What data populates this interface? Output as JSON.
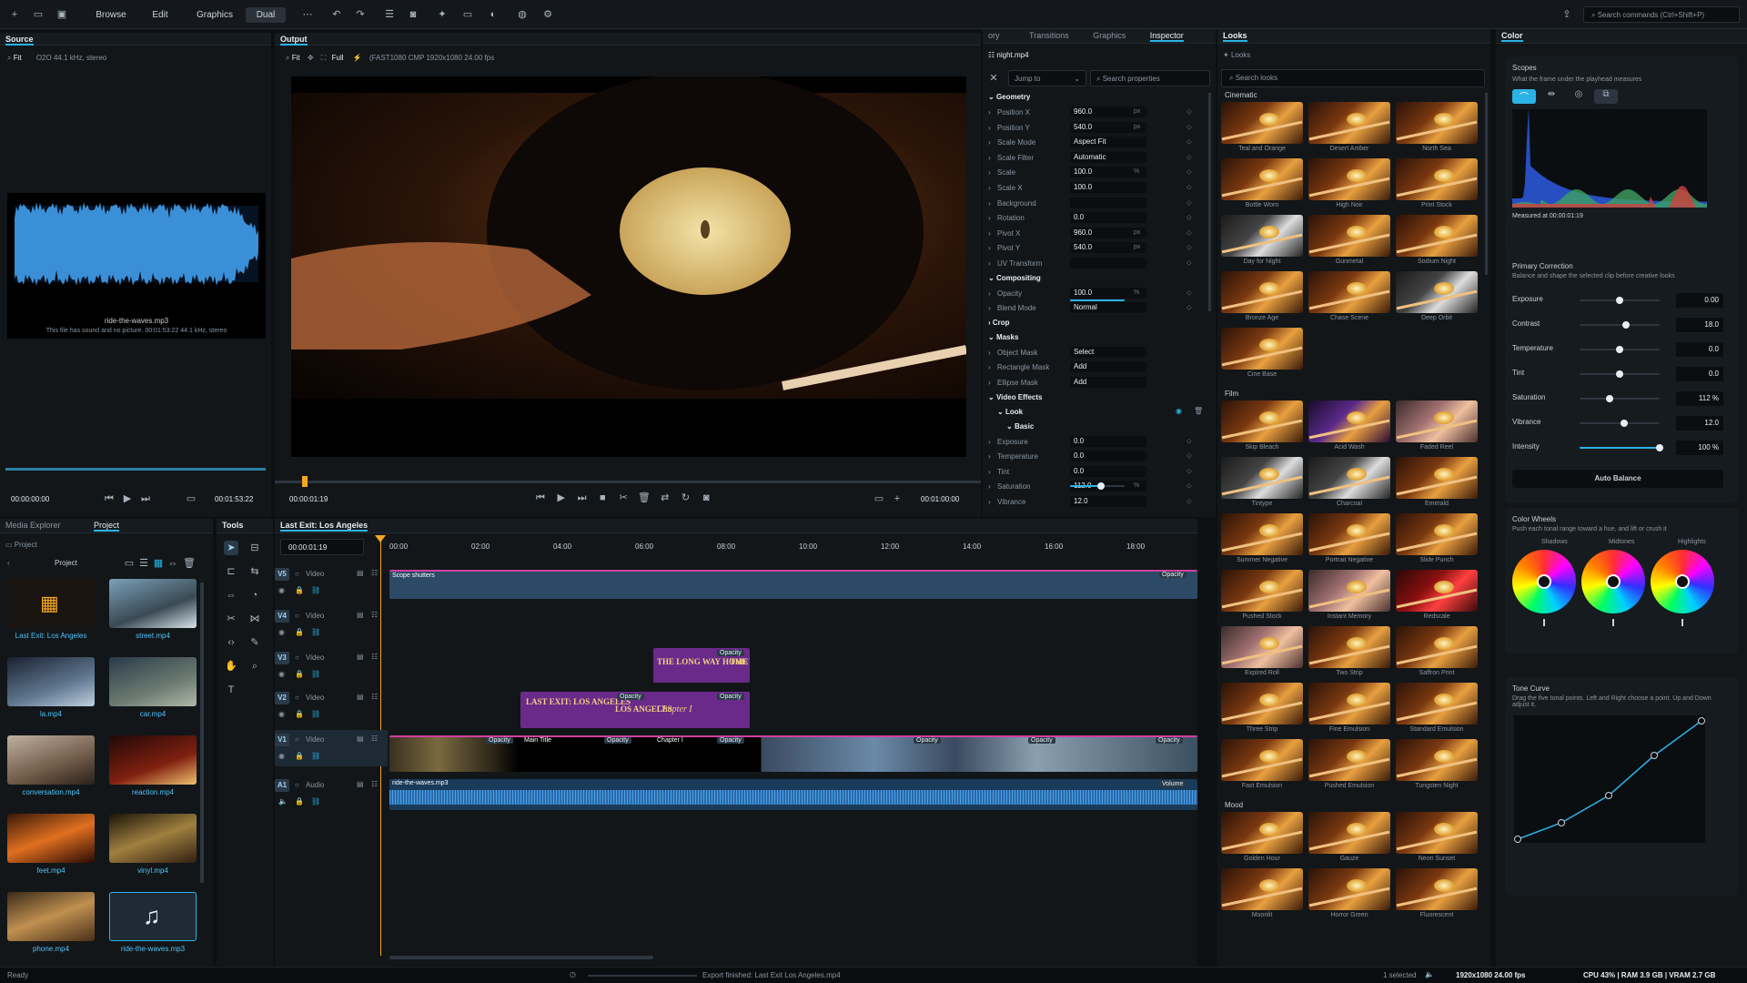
{
  "topbar": {
    "tabs": [
      "Browse",
      "Edit",
      "Graphics",
      "Dual"
    ],
    "active_tab": "Dual",
    "search_placeholder": "Search commands (Ctrl+Shift+P)"
  },
  "source": {
    "title": "Source",
    "fit": "Fit",
    "info": "O2O 44.1 kHz, stereo",
    "filename": "ride-the-waves.mp3",
    "note": "This file has sound and no picture. 00:01:53:22 44.1 kHz, stereo",
    "tc_start": "00:00:00:00",
    "tc_end": "00:01:53:22"
  },
  "output": {
    "title": "Output",
    "fit": "Fit",
    "full": "Full",
    "info": "(FAST1080 CMP 1920x1080 24.00 fps",
    "tc_current": "00:00:01:19",
    "tc_end": "00:01:00:00"
  },
  "inspector": {
    "tabs": [
      "ory",
      "Transitions",
      "Graphics",
      "Inspector"
    ],
    "active": "Inspector",
    "file": "night.mp4",
    "jump_to": "Jump to",
    "search_placeholder": "Search properties",
    "sections": {
      "geometry": "Geometry",
      "compositing": "Compositing",
      "crop": "Crop",
      "masks": "Masks",
      "video_effects": "Video Effects",
      "look": "Look",
      "basic": "Basic"
    },
    "geometry": [
      {
        "label": "Position X",
        "value": "960.0",
        "unit": "px"
      },
      {
        "label": "Position Y",
        "value": "540.0",
        "unit": "px"
      },
      {
        "label": "Scale Mode",
        "value": "Aspect Fit",
        "unit": ""
      },
      {
        "label": "Scale Filter",
        "value": "Automatic",
        "unit": ""
      },
      {
        "label": "Scale",
        "value": "100.0",
        "unit": "%"
      },
      {
        "label": "Scale X",
        "value": "100.0",
        "unit": ""
      },
      {
        "label": "Background",
        "value": "",
        "unit": ""
      },
      {
        "label": "Rotation",
        "value": "0.0",
        "unit": ""
      },
      {
        "label": "Pivot X",
        "value": "960.0",
        "unit": "px"
      },
      {
        "label": "Pivot Y",
        "value": "540.0",
        "unit": "px"
      },
      {
        "label": "UV Transform",
        "value": "",
        "unit": ""
      }
    ],
    "compositing": [
      {
        "label": "Opacity",
        "value": "100.0",
        "unit": "%"
      },
      {
        "label": "Blend Mode",
        "value": "Normal",
        "unit": ""
      }
    ],
    "masks": [
      {
        "label": "Object Mask",
        "value": "Select"
      },
      {
        "label": "Rectangle Mask",
        "value": "Add"
      },
      {
        "label": "Ellipse Mask",
        "value": "Add"
      }
    ],
    "basic": [
      {
        "label": "Exposure",
        "value": "0.0"
      },
      {
        "label": "Temperature",
        "value": "0.0"
      },
      {
        "label": "Tint",
        "value": "0.0"
      },
      {
        "label": "Saturation",
        "value": "112.0",
        "unit": "%"
      },
      {
        "label": "Vibrance",
        "value": "12.0"
      }
    ]
  },
  "looks": {
    "title": "Looks",
    "crumb": "Looks",
    "search_placeholder": "Search looks",
    "groups": [
      {
        "name": "Cinematic",
        "items": [
          "Teal and Orange",
          "Desert Amber",
          "North Sea",
          "Bottle Worn",
          "High Noir",
          "Print Stock",
          "Day for Night",
          "Gunmetal",
          "Sodium Night",
          "Bronze Age",
          "Chase Scene",
          "Deep Orbit",
          "Cine Base"
        ]
      },
      {
        "name": "Film",
        "items": [
          "Skip Bleach",
          "Acid Wash",
          "Faded Reel",
          "Tintype",
          "Charcoal",
          "Emerald",
          "Summer Negative",
          "Portrait Negative",
          "Slide Punch",
          "Pushed Stock",
          "Instant Memory",
          "Redscale",
          "Expired Roll",
          "Two Strip",
          "Saffron Print",
          "Three Strip",
          "Fine Emulsion",
          "Standard Emulsion",
          "Fast Emulsion",
          "Pushed Emulsion",
          "Tungsten Night"
        ]
      },
      {
        "name": "Mood",
        "items": [
          "Golden Hour",
          "Gauze",
          "Neon Sunset",
          "Moonlit",
          "Horror Green",
          "Fluorescent"
        ]
      }
    ]
  },
  "color": {
    "title": "Color",
    "scopes_title": "Scopes",
    "scopes_sub": "What the frame under the playhead measures",
    "measured": "Measured at 00:00:01:19",
    "primary_title": "Primary Correction",
    "primary_sub": "Balance and shape the selected clip before creative looks",
    "sliders": [
      {
        "label": "Exposure",
        "value": "0.00",
        "pos": 0.5
      },
      {
        "label": "Contrast",
        "value": "18.0",
        "pos": 0.58
      },
      {
        "label": "Temperature",
        "value": "0.0",
        "pos": 0.5
      },
      {
        "label": "Tint",
        "value": "0.0",
        "pos": 0.5
      },
      {
        "label": "Saturation",
        "value": "112 %",
        "pos": 0.37
      },
      {
        "label": "Vibrance",
        "value": "12.0",
        "pos": 0.56
      },
      {
        "label": "Intensity",
        "value": "100 %",
        "pos": 1.0
      }
    ],
    "auto_balance": "Auto Balance",
    "wheels_title": "Color Wheels",
    "wheels_sub": "Push each tonal range toward a hue, and lift or crush it",
    "wheels": [
      "Shadows",
      "Midtones",
      "Highlights"
    ],
    "curve_title": "Tone Curve",
    "curve_sub": "Drag the five tonal points. Left and Right choose a point. Up and Down adjust it."
  },
  "media": {
    "tabs": [
      "Media Explorer",
      "Project"
    ],
    "active": "Project",
    "crumb": "Project",
    "header": "Project",
    "items": [
      "Last Exit: Los Angeles",
      "street.mp4",
      "la.mp4",
      "car.mp4",
      "conversation.mp4",
      "reaction.mp4",
      "feet.mp4",
      "vinyl.mp4",
      "phone.mp4",
      "ride-the-waves.mp3"
    ]
  },
  "tools": {
    "title": "Tools"
  },
  "timeline": {
    "tab": "Last Exit: Los Angeles",
    "tc": "00:00:01:19",
    "ruler": [
      "00:00",
      "02:00",
      "04:00",
      "06:00",
      "08:00",
      "10:00",
      "12:00",
      "14:00",
      "16:00",
      "18:00"
    ],
    "tracks": [
      {
        "tag": "V5",
        "label": "Video"
      },
      {
        "tag": "V4",
        "label": "Video"
      },
      {
        "tag": "V3",
        "label": "Video"
      },
      {
        "tag": "V2",
        "label": "Video"
      },
      {
        "tag": "V1",
        "label": "Video"
      },
      {
        "tag": "A1",
        "label": "Audio"
      }
    ],
    "clips": {
      "v5": "Scope shutters",
      "v5_badge": "Opacity",
      "v3_title": "THE LONG WAY HOME",
      "v3_title2": "THE WA",
      "v2_title": "LAST EXIT: LOS ANGELES",
      "v2_title2": "LOS ANGELES",
      "v2_chapter": "Chapter I",
      "v1_main": "Main Title",
      "v1_chapter": "Chapter I",
      "audio": "ride-the-waves.mp3",
      "volume": "Volume",
      "opacity": "Opacity"
    }
  },
  "status": {
    "left": "Ready",
    "export": "Export finished: Last Exit Los Angeles.mp4",
    "selected": "1 selected",
    "res": "1920x1080 24.00 fps",
    "perf": "CPU 43% | RAM 3.9 GB | VRAM 2.7 GB"
  },
  "colors": {
    "accent": "#2bb3e6",
    "playhead": "#f5a623",
    "audio": "#3b8fd6"
  }
}
